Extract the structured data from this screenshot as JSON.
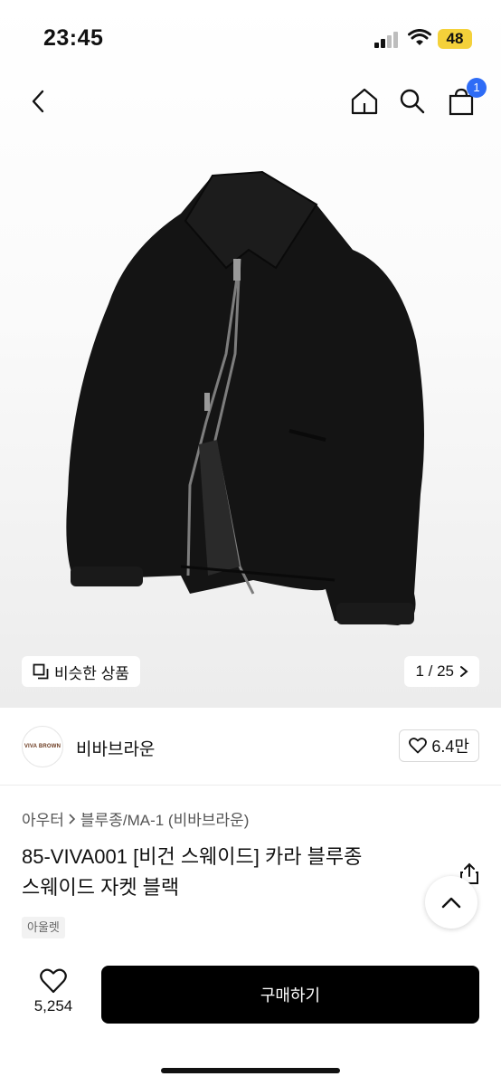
{
  "status": {
    "time": "23:45",
    "battery": "48"
  },
  "header": {
    "cart_count": "1"
  },
  "gallery": {
    "similar_label": "비슷한 상품",
    "counter": "1 / 25"
  },
  "brand": {
    "logo_text": "VIVA BROWN",
    "name": "비바브라운",
    "likes": "6.4만"
  },
  "breadcrumb": {
    "category": "아우터",
    "subcategory": "블루종/MA-1 (비바브라운)"
  },
  "product": {
    "title_line1": "85-VIVA001 [비건 스웨이드] 카라 블루종",
    "title_line2": "스웨이드 자켓 블랙",
    "tag": "아울렛"
  },
  "footer": {
    "wish_count": "5,254",
    "buy_label": "구매하기"
  },
  "colors": {
    "accent": "#2e6cf6",
    "battery": "#f4d13a",
    "buy_button": "#000000"
  }
}
